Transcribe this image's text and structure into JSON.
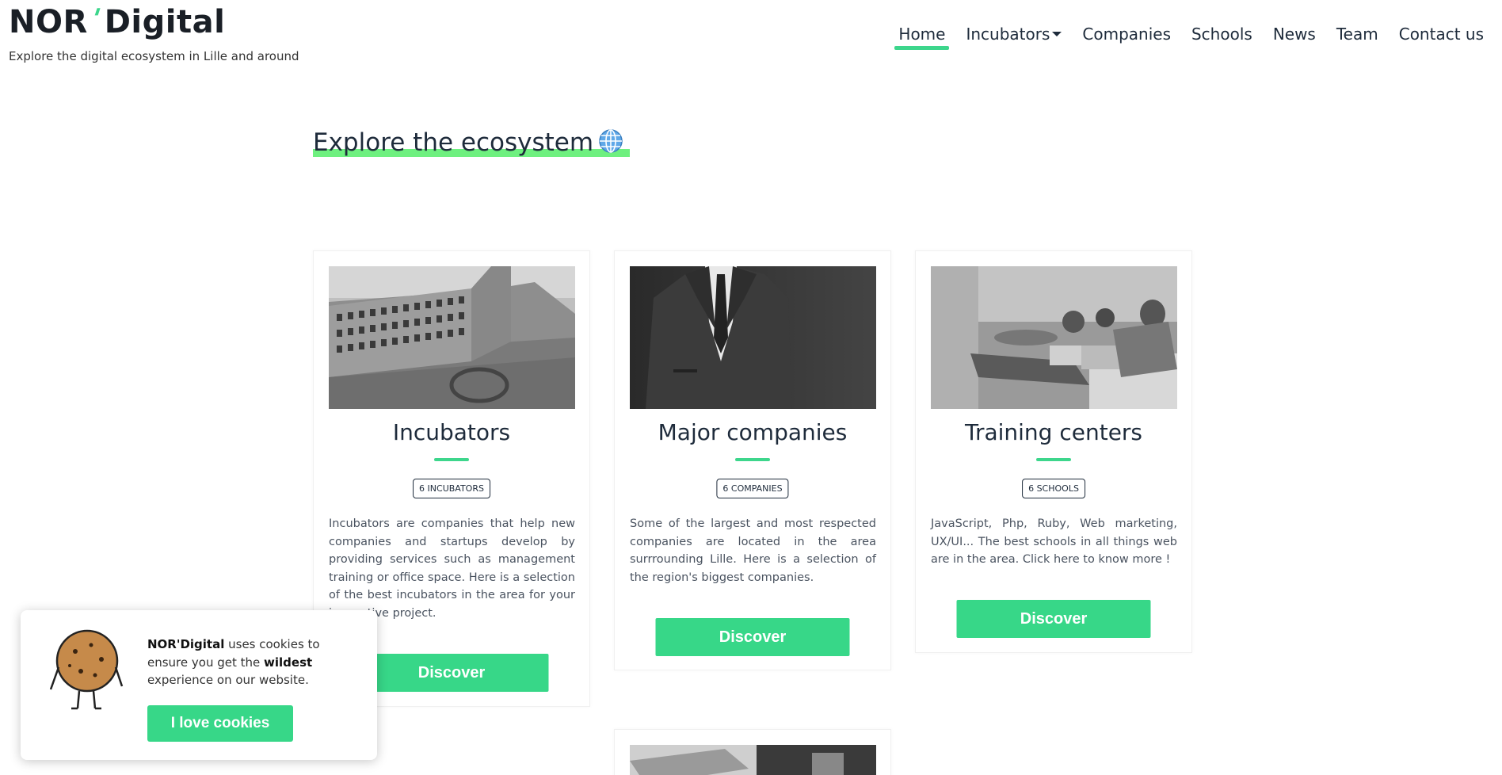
{
  "brand": {
    "name_part1": "NOR",
    "name_part2": "Digital",
    "tagline": "Explore the digital ecosystem in Lille and around"
  },
  "nav": {
    "items": [
      {
        "label": "Home",
        "active": true
      },
      {
        "label": "Incubators",
        "dropdown": true
      },
      {
        "label": "Companies"
      },
      {
        "label": "Schools"
      },
      {
        "label": "News"
      },
      {
        "label": "Team"
      },
      {
        "label": "Contact us"
      }
    ]
  },
  "section": {
    "title": "Explore the ecosystem",
    "icon": "globe-icon"
  },
  "cards": [
    {
      "title": "Incubators",
      "badge": "6 incubators",
      "text": "Incubators are companies that help new companies and startups develop by providing services such as management training or office space. Here is a selection of the best incubators in the area for your innovative project.",
      "button": "Discover"
    },
    {
      "title": "Major companies",
      "badge": "6 companies",
      "text": "Some of the largest and most respected companies are located in the area surrrounding Lille. Here is a selection of the region's biggest companies.",
      "button": "Discover"
    },
    {
      "title": "Training centers",
      "badge": "6 schools",
      "text": "JavaScript, Php, Ruby, Web marketing, UX/UI... The best schools in all things web are in the area. Click here to know more !",
      "button": "Discover"
    }
  ],
  "cookie": {
    "brand": "NOR'Digital",
    "text_part1": " uses cookies to ensure you get the ",
    "emphasis": "wildest",
    "text_part2": " experience on our website.",
    "button": "I love cookies"
  },
  "colors": {
    "accent": "#37d788",
    "highlight": "#6ef07f",
    "text_dark": "#1e2b3b"
  }
}
